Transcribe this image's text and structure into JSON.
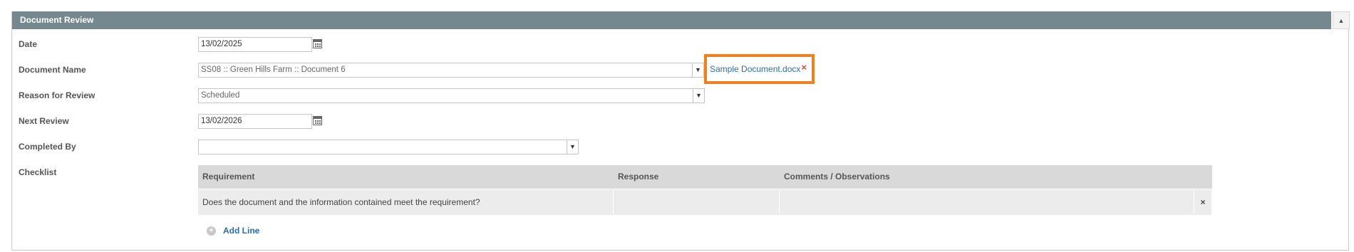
{
  "panel": {
    "title": "Document Review",
    "collapse_icon": "triangle-up-icon"
  },
  "fields": {
    "date": {
      "label": "Date",
      "value": "13/02/2025"
    },
    "document_name": {
      "label": "Document Name",
      "value": "SS08 :: Green Hills Farm :: Document 6",
      "attachment": "Sample Document.docx"
    },
    "reason": {
      "label": "Reason for Review",
      "value": "Scheduled"
    },
    "next_review": {
      "label": "Next Review",
      "value": "13/02/2026"
    },
    "completed_by": {
      "label": "Completed By",
      "value": ""
    },
    "checklist": {
      "label": "Checklist"
    }
  },
  "checklist_table": {
    "columns": [
      "Requirement",
      "Response",
      "Comments / Observations"
    ],
    "rows": [
      {
        "requirement": "Does the document and the information contained meet the requirement?",
        "response": "",
        "comments": ""
      }
    ],
    "add_line_label": "Add Line"
  },
  "colors": {
    "header_bg": "#75878f",
    "highlight": "#f08121",
    "link": "#2a6ea8",
    "remove": "#e04040"
  }
}
